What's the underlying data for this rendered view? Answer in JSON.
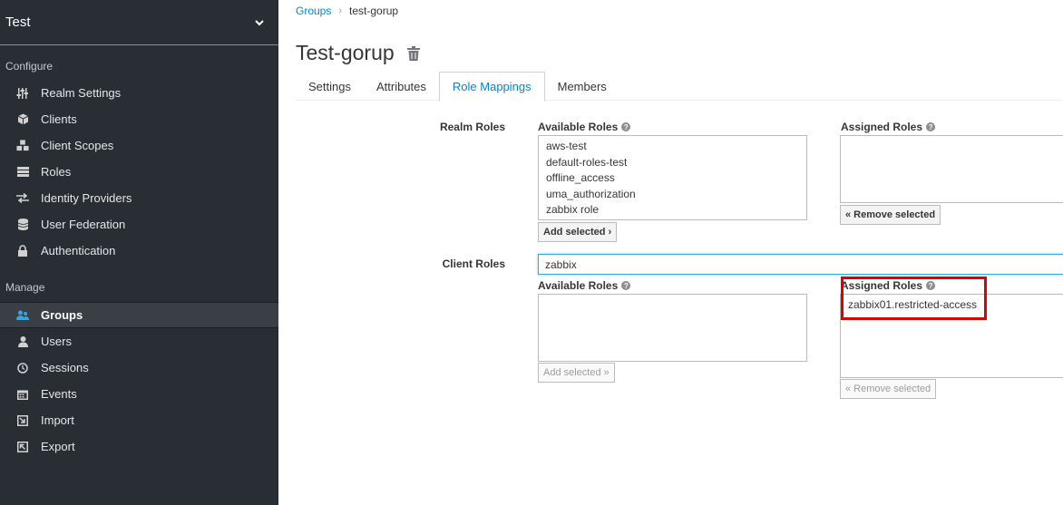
{
  "realm": {
    "name": "Test"
  },
  "sidebar": {
    "configure_label": "Configure",
    "manage_label": "Manage",
    "configure_items": [
      {
        "label": "Realm Settings",
        "icon": "sliders-icon"
      },
      {
        "label": "Clients",
        "icon": "cube-icon"
      },
      {
        "label": "Client Scopes",
        "icon": "cubes-icon"
      },
      {
        "label": "Roles",
        "icon": "roles-list-icon"
      },
      {
        "label": "Identity Providers",
        "icon": "exchange-icon"
      },
      {
        "label": "User Federation",
        "icon": "database-icon"
      },
      {
        "label": "Authentication",
        "icon": "lock-icon"
      }
    ],
    "manage_items": [
      {
        "label": "Groups",
        "icon": "users-icon",
        "active": true
      },
      {
        "label": "Users",
        "icon": "user-icon"
      },
      {
        "label": "Sessions",
        "icon": "clock-icon"
      },
      {
        "label": "Events",
        "icon": "calendar-icon"
      },
      {
        "label": "Import",
        "icon": "import-icon"
      },
      {
        "label": "Export",
        "icon": "export-icon"
      }
    ]
  },
  "breadcrumb": {
    "parent": "Groups",
    "current": "test-gorup"
  },
  "page": {
    "title": "Test-gorup"
  },
  "tabs": [
    "Settings",
    "Attributes",
    "Role Mappings",
    "Members"
  ],
  "active_tab": "Role Mappings",
  "realm_roles": {
    "label": "Realm Roles",
    "available_label": "Available Roles",
    "assigned_label": "Assigned Roles",
    "available": [
      "aws-test",
      "default-roles-test",
      "offline_access",
      "uma_authorization",
      "zabbix role"
    ],
    "assigned": [],
    "add_button": "Add selected ›",
    "remove_button": "« Remove selected"
  },
  "client_roles": {
    "label": "Client Roles",
    "client_value": "zabbix",
    "available_label": "Available Roles",
    "assigned_label": "Assigned Roles",
    "available": [],
    "assigned": [
      "zabbix01.restricted-access"
    ],
    "add_button": "Add selected »",
    "remove_button": "« Remove selected"
  },
  "colors": {
    "sidebar_bg": "#292e34",
    "link": "#0088ce",
    "highlight": "#e10000"
  }
}
